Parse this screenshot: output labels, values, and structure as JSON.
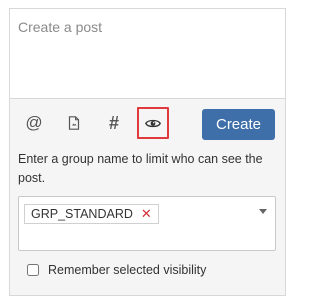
{
  "composer": {
    "placeholder": "Create a post",
    "value": ""
  },
  "toolbar": {
    "items": [
      {
        "icon": "at-icon",
        "glyph": "@"
      },
      {
        "icon": "file-icon",
        "glyph": ""
      },
      {
        "icon": "hashtag-icon",
        "glyph": "#"
      },
      {
        "icon": "eye-icon",
        "glyph": "",
        "selected": true
      }
    ],
    "create_label": "Create",
    "create_color": "#3e6fa8",
    "highlight_color": "#e0393e"
  },
  "visibility": {
    "hint": "Enter a group name to limit who can see the post.",
    "selected_groups": [
      "GRP_STANDARD"
    ],
    "remove_glyph": "✕",
    "remember_label": "Remember selected visibility",
    "remember_checked": false
  }
}
